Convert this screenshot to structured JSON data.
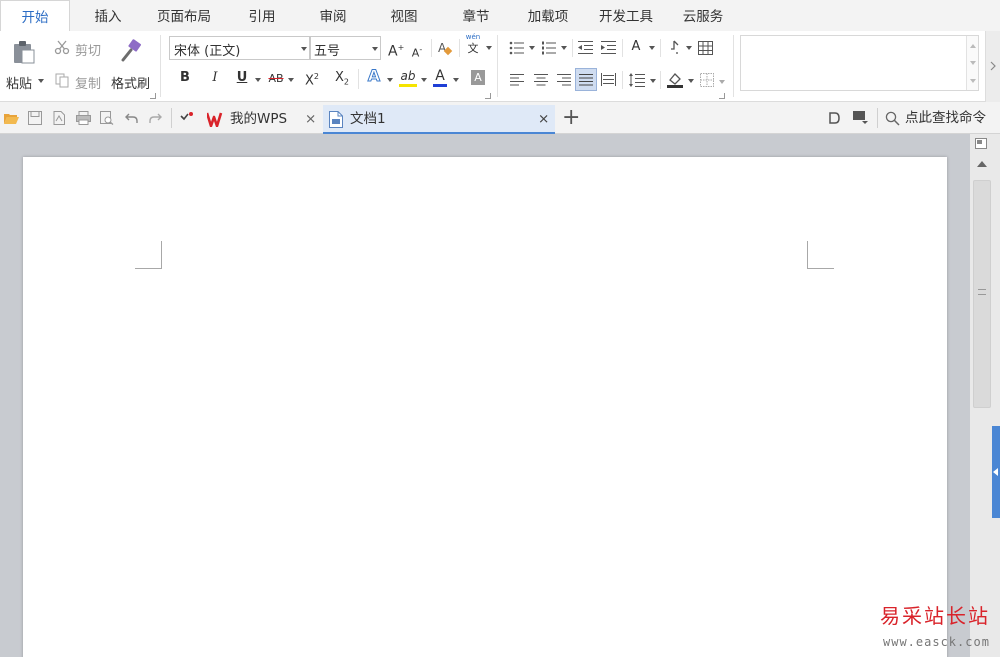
{
  "menu": {
    "tabs": [
      {
        "label": "开始",
        "active": true
      },
      {
        "label": "插入"
      },
      {
        "label": "页面布局"
      },
      {
        "label": "引用"
      },
      {
        "label": "审阅"
      },
      {
        "label": "视图"
      },
      {
        "label": "章节"
      },
      {
        "label": "加载项"
      },
      {
        "label": "开发工具"
      },
      {
        "label": "云服务"
      }
    ]
  },
  "ribbon": {
    "paste_label": "粘贴",
    "cut_label": "剪切",
    "copy_label": "复制",
    "format_painter_label": "格式刷",
    "font_name": "宋体 (正文)",
    "font_size": "五号",
    "bold": "B",
    "italic": "I",
    "underline": "U",
    "strike": "AB",
    "superscript": "X",
    "superscript_mark": "2",
    "subscript": "X",
    "subscript_mark": "2",
    "text_effect": "A",
    "highlight": "ab",
    "font_color": "A",
    "char_shading": "A",
    "grow_font": "A",
    "grow_mark": "+",
    "shrink_font": "A",
    "shrink_mark": "-",
    "phonetic_top": "wén",
    "phonetic_bottom": "文",
    "text_direction": "A",
    "accent_color": "#2b6cc4"
  },
  "tabbar": {
    "my_wps": "我的WPS",
    "document": "文档1",
    "search_command": "点此查找命令",
    "close_glyph": "×",
    "new_tab_glyph": "+"
  },
  "watermark": {
    "title": "易采站长站",
    "url": "www.easck.com"
  }
}
